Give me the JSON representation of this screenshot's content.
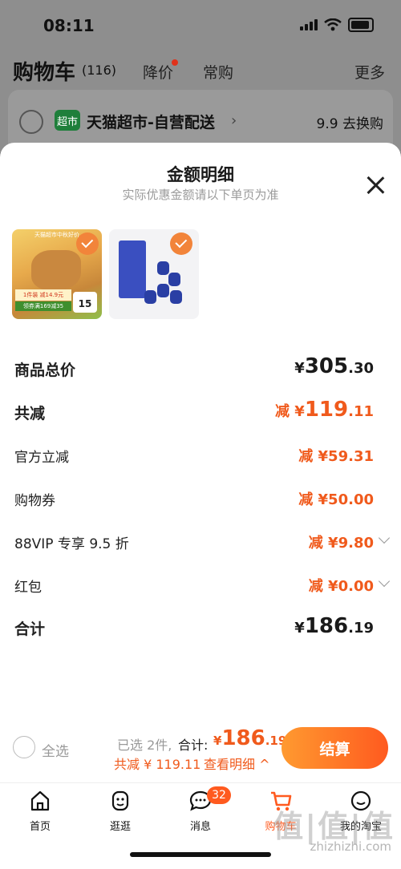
{
  "status": {
    "time": "08:11"
  },
  "cart": {
    "title": "购物车",
    "count": "(116)",
    "tabs": [
      "降价",
      "常购"
    ],
    "more": "更多"
  },
  "store": {
    "badge": "超市",
    "name": "天猫超市-自营配送",
    "promo": "9.9 去换购"
  },
  "sheet": {
    "title": "金额明细",
    "subtitle": "实际优惠金额请以下单页为准",
    "thumb1": {
      "top": "天猫超市中秋好价",
      "bar1": "1件装 减14.9元",
      "bar2": "领券满169减35",
      "price": "15"
    }
  },
  "rows": [
    {
      "label": "商品总价",
      "currency": "¥",
      "int": "305",
      "dec": ".30"
    },
    {
      "label": "共减",
      "prefix": "减 ",
      "currency": "¥",
      "int": "119",
      "dec": ".11"
    },
    {
      "label": "官方立减",
      "prefix": "减 ",
      "currency": "¥",
      "int": "59",
      "dec": ".31"
    },
    {
      "label": "购物券",
      "prefix": "减 ",
      "currency": "¥",
      "int": "50",
      "dec": ".00"
    },
    {
      "label": "88VIP 专享 9.5 折",
      "prefix": "减 ",
      "currency": "¥",
      "int": "9",
      "dec": ".80"
    },
    {
      "label": "红包",
      "prefix": "减 ",
      "currency": "¥",
      "int": "0",
      "dec": ".00"
    },
    {
      "label": "合计",
      "currency": "¥",
      "int": "186",
      "dec": ".19"
    }
  ],
  "bottom": {
    "select_all": "全选",
    "selected": "已选 2件,",
    "total_label": "合计:",
    "currency": "¥",
    "amount_int": "186",
    "amount_dec": ".19",
    "saved": "共减 ¥ 119.11",
    "detail": "查看明细 ^",
    "checkout": "结算"
  },
  "tabbar": {
    "items": [
      "首页",
      "逛逛",
      "消息",
      "购物车",
      "我的淘宝"
    ],
    "message_badge": "32",
    "active": "购物车"
  },
  "watermark": {
    "main": "值|值|值",
    "sub": "zhizhizhi.com"
  }
}
